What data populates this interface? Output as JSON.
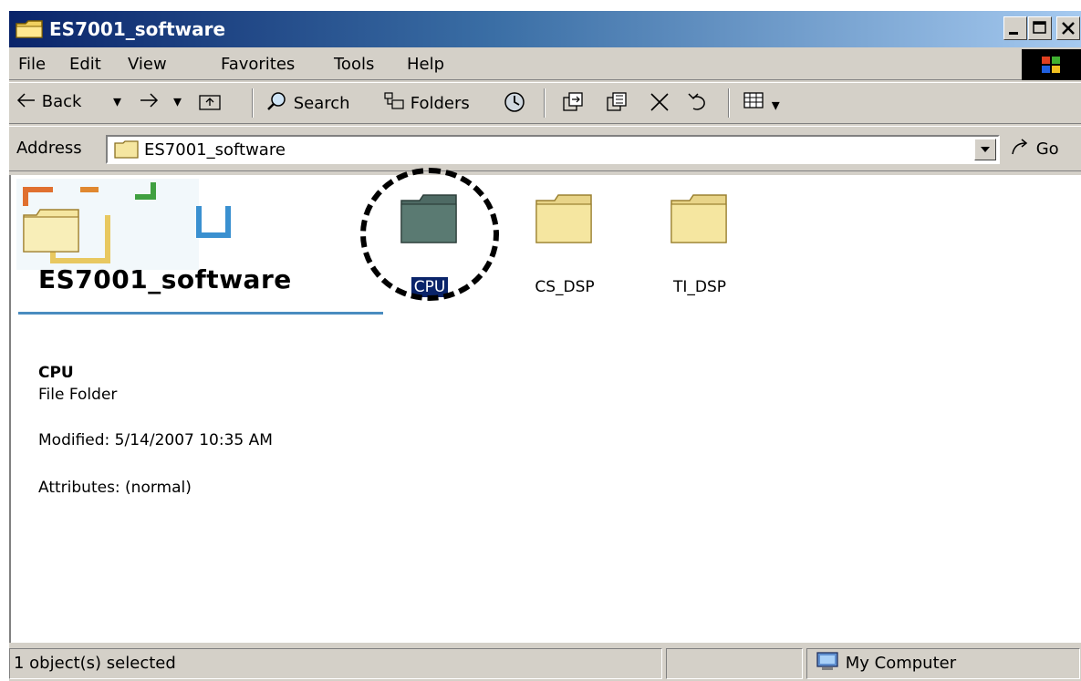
{
  "window": {
    "title": "ES7001_software"
  },
  "menu": {
    "items": [
      {
        "label": "File"
      },
      {
        "label": "Edit"
      },
      {
        "label": "View"
      },
      {
        "label": "Favorites"
      },
      {
        "label": "Tools"
      },
      {
        "label": "Help"
      }
    ]
  },
  "toolbar": {
    "back_label": "Back",
    "search_label": "Search",
    "folders_label": "Folders"
  },
  "address": {
    "label": "Address",
    "value": "ES7001_software",
    "go_label": "Go"
  },
  "content": {
    "folder_title": "ES7001_software",
    "details": {
      "name": "CPU",
      "type": "File Folder",
      "modified": "Modified: 5/14/2007 10:35 AM",
      "attributes": "Attributes: (normal)"
    },
    "items": [
      {
        "label": "CPU",
        "selected": true
      },
      {
        "label": "CS_DSP",
        "selected": false
      },
      {
        "label": "TI_DSP",
        "selected": false
      }
    ]
  },
  "status": {
    "selection": "1 object(s) selected",
    "zone": "My Computer"
  },
  "colors": {
    "selection": "#0a246a",
    "folder": "#f5e6a0",
    "selected_folder": "#5a7a72",
    "accent_line": "#4a8cc0"
  }
}
